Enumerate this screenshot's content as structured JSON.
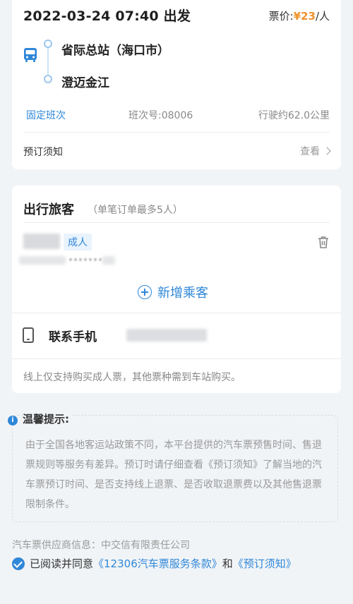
{
  "trip": {
    "departure": "2022-03-24 07:40 出发",
    "price_prefix": "票价:",
    "price": "¥23",
    "price_suffix": "/人",
    "from_station": "省际总站（海口市）",
    "to_station": "澄迈金江",
    "schedule_type": "固定班次",
    "schedule_no": "班次号:08006",
    "distance": "行驶约62.0公里",
    "notice_label": "预订须知",
    "view_label": "查看"
  },
  "passengers": {
    "title": "出行旅客",
    "hint": "（单笔订单最多5人）",
    "items": [
      {
        "type_tag": "成人",
        "masked_id": "*******"
      }
    ],
    "add_label": "新增乘客",
    "contact_label": "联系手机",
    "adult_only_note": "线上仅支持购买成人票，其他票种需到车站购买。"
  },
  "tips": {
    "icon": "i",
    "title": "温馨提示:",
    "body": "由于全国各地客运站政策不同，本平台提供的汽车票预售时间、售退票规则等服务有差异。预订时请仔细查看《预订须知》了解当地的汽车票预订时间、是否支持线上退票、是否收取退票费以及其他售退票限制条件。"
  },
  "footer": {
    "supplier": "汽车票供应商信息：中交信有限责任公司",
    "agree_prefix": "已阅读并同意",
    "terms_link": "《12306汽车票服务条款》",
    "and": "和",
    "notice_link": "《预订须知》"
  },
  "colors": {
    "accent": "#2f87d8",
    "price": "#f0922a",
    "background": "#f1f4f7"
  },
  "icons": [
    "bus-icon",
    "trash-icon",
    "add-circle-icon",
    "phone-icon",
    "info-icon",
    "check-circle-icon",
    "chevron-right-icon"
  ]
}
